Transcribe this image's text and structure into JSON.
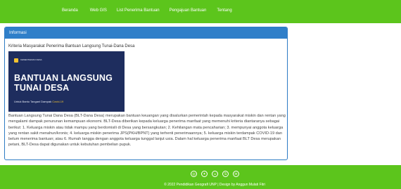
{
  "nav": {
    "items": [
      "Beranda",
      "Web GIS",
      "List Penerima Bantuan",
      "Pengajuan Bantuan",
      "Tentang"
    ]
  },
  "panel": {
    "title": "Informasi",
    "criteria_heading": "Kriteria Masyarakat Penerima Bantuan Langsung Tunai-Dana Desa",
    "banner": {
      "logo_text": "KEMENTERIAN DESA",
      "title_line1": "BANTUAN LANGSUNG",
      "title_line2": "TUNAI DESA",
      "subtitle_prefix": "Untuk Bantu Tangani Dampak ",
      "subtitle_highlight": "Covid-19"
    },
    "description": "Bantuan Langsung Tunai Dana Desa (BLT-Dana Desa) merupakan bantuan keuangan yang disalurkan pemerintah kepada masyarakat miskin dan rentan yang mengalami dampak penurunan kemampuan ekonomi. BLT-Desa diberikan kepada keluarga penerima manfaat yang memenuhi kriteria diantaranya sebagai berikut: 1. Keluarga miskin atau tidak mampu yang berdomisili di Desa yang bersangkutan; 2. Kehilangan mata pencaharian; 3. mempunyai anggota keluarga yang rentan sakit menahun/kronis; 4. keluarga miskin penerima JPS(PKH/BPNT) yang terhenti penerimaannya; 5. keluarga miskin terdampak COVID-19 dan belum menerima bantuan; atau 6. Rumah tangga dengan anggota keluarga tunggal lanjut usia. Dalam hal keluarga penerima manfaat BLT Desa merupakan petani, BLT-Desa dapat digunakan untuk kebutuhan pembelian pupuk."
  },
  "footer": {
    "social_icons": [
      "instagram-icon",
      "twitter-icon",
      "chat-icon",
      "skype-icon",
      "linkedin-icon"
    ],
    "social_glyphs": [
      "◎",
      "✦",
      "☺",
      "S",
      "in"
    ],
    "copyright": "© 2022 Pendidikan Geografi UNP | Design by Anggun Mulati Fitri"
  },
  "colors": {
    "brand_green": "#5cc51c",
    "panel_blue": "#2f7fc9",
    "banner_navy": "#1e2d5e",
    "accent_yellow": "#f2c230"
  }
}
